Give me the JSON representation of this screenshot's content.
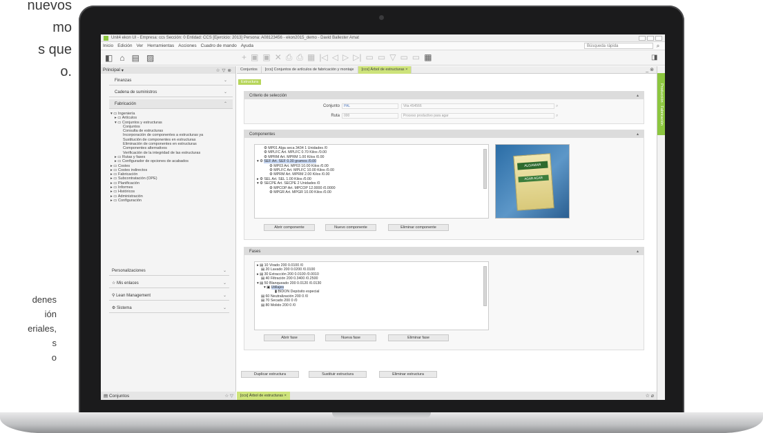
{
  "background_text": {
    "top_lines": [
      "nuevos",
      "mo",
      "s que",
      "o."
    ],
    "bottom_lines": [
      "denes",
      "ión",
      "eriales,",
      "s",
      "o"
    ]
  },
  "app": {
    "title": "Unit4 ekon UI - Empresa: ccs Sección: 0 Entidad: CCS [Ejercicio: 2013] Persona: A08123456 - ekon2015_demo - David Ballester Amat",
    "menu": [
      "Inicio",
      "Edición",
      "Ver",
      "Herramientas",
      "Acciones",
      "Cuadro de mando",
      "Ayuda"
    ],
    "quick_search_label": "Búsqueda rápida"
  },
  "sidebar": {
    "header": "Principal",
    "sections": [
      {
        "label": "Finanzas"
      },
      {
        "label": "Cadena de suministros"
      },
      {
        "label": "Fabricación"
      }
    ],
    "tree": [
      "Ingeniería",
      "Artículos",
      "Conjuntos y estructuras",
      "Conjuntos",
      "Consulta de estructuras",
      "Incorporación de componentes a estructuras ya",
      "Sustitución de componentes en estructuras",
      "Eliminación de componentes en estructuras",
      "Componentes alternativos",
      "Verificación de la integridad de las estructuras",
      "Rutas y fases",
      "Configurador de opciones de acabados",
      "Costes",
      "Costes indirectos",
      "Fabricación",
      "Subcontratación (OPE)",
      "Planificación",
      "Informes",
      "Históricos",
      "Administración",
      "Configuración"
    ],
    "bottom_items": [
      {
        "label": "Personalizaciones"
      },
      {
        "label": "Mis enlaces"
      },
      {
        "label": "Lean Management"
      },
      {
        "label": "Sistema"
      }
    ],
    "footer": "Conjuntos"
  },
  "main": {
    "tabs": [
      "Conjuntos",
      "[ccs] Conjuntos de artículos de fabricación y montaje",
      "[ccs] Árbol de estructuras"
    ],
    "subtab": "Estructura",
    "criteria": {
      "title": "Criterio de selección",
      "conjunto_label": "Conjunto",
      "conjunto_value": "PAL",
      "conjunto_desc": "Vita 454566",
      "ruta_label": "Ruta",
      "ruta_value": "000",
      "ruta_desc": "Proceso productivo para agar"
    },
    "components": {
      "title": "Componentes",
      "items": [
        "MP01 Alga seca 3434 1 Unidades /0",
        "MPLFC Art. MPLFC 0.70 Kilos /0.00",
        "MPRM Art. MPRM 1.00 Kilos /0.00",
        "SEF Art. SEF 0.30 gramos /0.00",
        "MP03 Art. MP03 10.00 Kilos /0.00",
        "MPLFC Art. MPLFC 10.00 Kilos /0.00",
        "MPRM Art. MPRM 2.00 Kilos /0.00",
        "SEL Art. SEL 1.00 Kilos /0.00",
        "SECPE Art. SECPE 2 Unidades /0",
        "MPCOP Art. MPCOP 12.0000 /0.0000",
        "MPGR Art. MPGR 10.00 Kilos /0.00"
      ],
      "buttons": [
        "Abrir componente",
        "Nuevo componente",
        "Eliminar componente"
      ],
      "product_label": "AGAR AGAR",
      "product_brand": "ALGAMAR"
    },
    "phases": {
      "title": "Fases",
      "items": [
        "10 Virado 200 0.0100 /0",
        "20 Lavado 200 0.0200 /0.0100",
        "30 Extracción 200 0.0100 /0.0010",
        "40 Filtración 200 0.3400 /0.2500",
        "50 Blanqueado 200 0.0120 /0.0130",
        "Utillajes",
        "BIDON Depósito especial",
        "60 Neutralización 200 0 /0",
        "70 Secado 200 0 /0",
        "80 Molido 200 0 /0"
      ],
      "buttons": [
        "Abrir fase",
        "Nueva fase",
        "Eliminar fase"
      ]
    },
    "structure_buttons": [
      "Duplicar estructura",
      "Sustituir estructura",
      "Eliminar estructura"
    ],
    "bottom_tab": "[ccs] Árbol de estructuras"
  },
  "right_rail": {
    "tab": "Producción · Fabricación"
  },
  "colors": {
    "accent_green": "#8cc63f",
    "tab_green": "#cde37a"
  }
}
